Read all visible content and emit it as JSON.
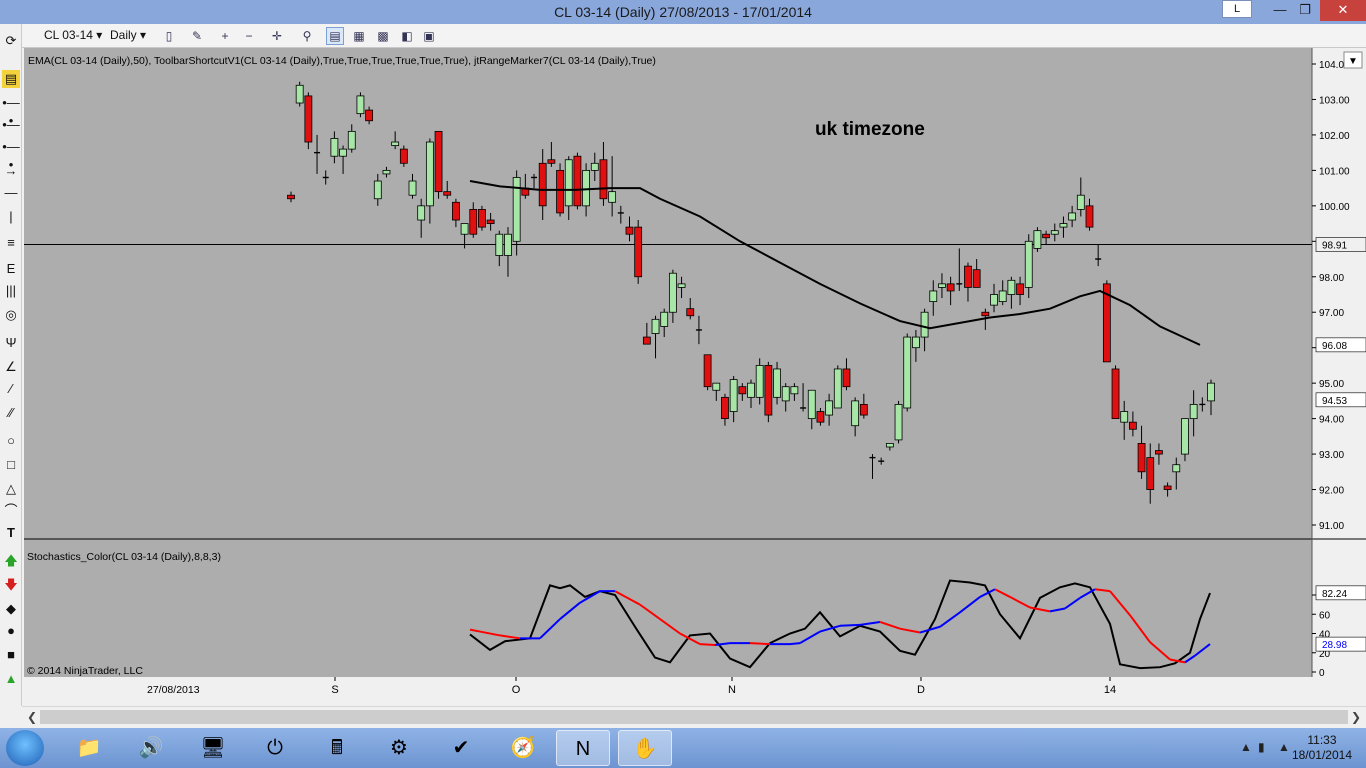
{
  "window": {
    "title": "CL 03-14 (Daily)  27/08/2013 - 17/01/2014",
    "keyboard_indicator": "L"
  },
  "toolbar": {
    "instrument": "CL 03-14",
    "period": "Daily"
  },
  "chart": {
    "indicator_label": "EMA(CL 03-14 (Daily),50), ToolbarShortcutV1(CL 03-14 (Daily),True,True,True,True,True,True), jtRangeMarker7(CL 03-14 (Daily),True)",
    "stoch_label": "Stochastics_Color(CL 03-14 (Daily),8,8,3)",
    "annotation": "uk timezone",
    "copyright": "© 2014 NinjaTrader, LLC",
    "start_date": "27/08/2013",
    "x_labels": [
      "S",
      "O",
      "N",
      "D",
      "14"
    ],
    "price_ticks": [
      "104.0",
      "103.00",
      "102.00",
      "101.00",
      "100.00",
      "99.00",
      "98.00",
      "97.00",
      "96.00",
      "95.00",
      "94.00",
      "93.00",
      "92.00",
      "91.00"
    ],
    "price_markers": {
      "hline": "98.91",
      "ema": "96.08",
      "last": "94.53"
    },
    "stoch_ticks": [
      "80",
      "60",
      "40",
      "20",
      "0"
    ],
    "stoch_markers": {
      "k": "82.24",
      "d": "28.98"
    },
    "colors": {
      "background": "#adadad",
      "up": "#a8e6a8",
      "down": "#e01010",
      "ema": "#000000",
      "stoch_k": "#000000",
      "stoch_d": "#0000ff",
      "stoch_d_down": "#ff0000"
    }
  },
  "chart_data": [
    {
      "type": "candlestick",
      "title": "CL 03-14 (Daily)",
      "ylim": [
        90.6,
        104.2
      ],
      "horizontal_line": 98.91,
      "candles": [
        [
          100.3,
          100.4,
          100.1,
          100.2
        ],
        [
          102.9,
          103.5,
          102.8,
          103.4
        ],
        [
          103.1,
          103.2,
          101.6,
          101.8
        ],
        [
          101.5,
          102.0,
          100.9,
          101.5
        ],
        [
          100.8,
          101.0,
          100.6,
          100.8
        ],
        [
          101.4,
          102.1,
          101.2,
          101.9
        ],
        [
          101.4,
          101.7,
          100.9,
          101.6
        ],
        [
          101.6,
          102.3,
          101.5,
          102.1
        ],
        [
          102.6,
          103.2,
          102.5,
          103.1
        ],
        [
          102.7,
          102.8,
          102.3,
          102.4
        ],
        [
          100.2,
          100.9,
          100.0,
          100.7
        ],
        [
          100.9,
          101.1,
          100.8,
          101.0
        ],
        [
          101.7,
          102.1,
          101.6,
          101.8
        ],
        [
          101.6,
          101.7,
          101.1,
          101.2
        ],
        [
          100.3,
          100.9,
          100.2,
          100.7
        ],
        [
          99.6,
          100.2,
          99.1,
          100.0
        ],
        [
          100.0,
          101.9,
          99.5,
          101.8
        ],
        [
          102.1,
          102.1,
          100.2,
          100.4
        ],
        [
          100.4,
          100.7,
          100.2,
          100.3
        ],
        [
          100.1,
          100.2,
          99.4,
          99.6
        ],
        [
          99.2,
          99.5,
          98.8,
          99.5
        ],
        [
          99.9,
          100.1,
          99.1,
          99.2
        ],
        [
          99.9,
          100.0,
          99.3,
          99.4
        ],
        [
          99.6,
          99.8,
          99.3,
          99.5
        ],
        [
          98.6,
          99.3,
          98.3,
          99.2
        ],
        [
          98.6,
          99.4,
          98.0,
          99.2
        ],
        [
          99.0,
          101.0,
          98.6,
          100.8
        ],
        [
          100.5,
          100.9,
          100.2,
          100.3
        ],
        [
          100.8,
          100.9,
          100.5,
          100.8
        ],
        [
          101.2,
          101.6,
          99.6,
          100.0
        ],
        [
          101.3,
          101.8,
          101.1,
          101.2
        ],
        [
          101.0,
          101.2,
          99.7,
          99.8
        ],
        [
          100.0,
          101.4,
          99.6,
          101.3
        ],
        [
          101.4,
          101.5,
          99.9,
          100.0
        ],
        [
          100.0,
          101.2,
          99.7,
          101.0
        ],
        [
          101.0,
          101.5,
          100.7,
          101.2
        ],
        [
          101.3,
          101.8,
          100.0,
          100.2
        ],
        [
          100.1,
          101.4,
          99.7,
          100.4
        ],
        [
          99.8,
          100.0,
          99.5,
          99.8
        ],
        [
          99.4,
          99.7,
          99.0,
          99.2
        ],
        [
          99.4,
          99.6,
          97.8,
          98.0
        ],
        [
          96.3,
          96.7,
          96.1,
          96.1
        ],
        [
          96.4,
          96.9,
          95.7,
          96.8
        ],
        [
          96.6,
          97.1,
          96.3,
          97.0
        ],
        [
          97.0,
          98.2,
          96.7,
          98.1
        ],
        [
          97.7,
          98.0,
          97.4,
          97.8
        ],
        [
          97.1,
          97.4,
          96.8,
          96.9
        ],
        [
          96.5,
          96.9,
          96.1,
          96.5
        ],
        [
          95.8,
          95.8,
          94.8,
          94.9
        ],
        [
          94.8,
          95.0,
          94.5,
          95.0
        ],
        [
          94.6,
          94.7,
          93.8,
          94.0
        ],
        [
          94.2,
          95.2,
          93.9,
          95.1
        ],
        [
          94.9,
          95.0,
          94.5,
          94.7
        ],
        [
          94.6,
          95.1,
          94.3,
          95.0
        ],
        [
          94.6,
          95.7,
          94.4,
          95.5
        ],
        [
          95.5,
          95.6,
          93.9,
          94.1
        ],
        [
          94.6,
          95.6,
          94.4,
          95.4
        ],
        [
          94.5,
          95.0,
          94.2,
          94.9
        ],
        [
          94.7,
          95.0,
          94.5,
          94.9
        ],
        [
          94.3,
          95.0,
          94.2,
          94.3
        ],
        [
          94.0,
          94.8,
          93.7,
          94.8
        ],
        [
          94.2,
          94.3,
          93.8,
          93.9
        ],
        [
          94.1,
          94.7,
          93.8,
          94.5
        ],
        [
          94.3,
          95.5,
          94.3,
          95.4
        ],
        [
          95.4,
          95.7,
          94.8,
          94.9
        ],
        [
          93.8,
          94.6,
          93.5,
          94.5
        ],
        [
          94.4,
          94.7,
          94.0,
          94.1
        ],
        [
          92.9,
          93.0,
          92.3,
          92.9
        ],
        [
          92.8,
          92.9,
          92.7,
          92.8
        ],
        [
          93.2,
          93.3,
          93.1,
          93.3
        ],
        [
          93.4,
          94.5,
          93.3,
          94.4
        ],
        [
          94.3,
          96.4,
          94.2,
          96.3
        ],
        [
          96.0,
          96.5,
          95.6,
          96.3
        ],
        [
          96.3,
          97.1,
          95.9,
          97.0
        ],
        [
          97.3,
          97.9,
          96.9,
          97.6
        ],
        [
          97.7,
          98.1,
          97.4,
          97.8
        ],
        [
          97.8,
          98.0,
          97.2,
          97.6
        ],
        [
          97.8,
          98.8,
          97.6,
          97.8
        ],
        [
          98.3,
          98.4,
          97.3,
          97.7
        ],
        [
          98.2,
          98.5,
          97.8,
          97.7
        ],
        [
          97.0,
          97.1,
          96.5,
          96.9
        ],
        [
          97.2,
          97.8,
          97.0,
          97.5
        ],
        [
          97.3,
          97.9,
          97.2,
          97.6
        ],
        [
          97.5,
          98.0,
          97.1,
          97.9
        ],
        [
          97.8,
          98.0,
          97.2,
          97.5
        ],
        [
          97.7,
          99.2,
          97.4,
          99.0
        ],
        [
          98.8,
          99.4,
          98.7,
          99.3
        ],
        [
          99.2,
          99.3,
          98.9,
          99.1
        ],
        [
          99.2,
          99.5,
          99.0,
          99.3
        ],
        [
          99.4,
          99.7,
          99.1,
          99.5
        ],
        [
          99.6,
          100.0,
          99.4,
          99.8
        ],
        [
          99.9,
          100.8,
          99.7,
          100.3
        ],
        [
          100.0,
          100.2,
          99.3,
          99.4
        ],
        [
          98.5,
          98.9,
          98.3,
          98.5
        ],
        [
          97.8,
          97.9,
          96.0,
          95.6
        ],
        [
          95.4,
          95.5,
          94.2,
          94.0
        ],
        [
          93.9,
          94.5,
          93.4,
          94.2
        ],
        [
          93.9,
          94.2,
          93.5,
          93.7
        ],
        [
          93.3,
          93.8,
          92.3,
          92.5
        ],
        [
          92.9,
          93.3,
          91.6,
          92.0
        ],
        [
          93.1,
          93.3,
          92.7,
          93.0
        ],
        [
          92.1,
          92.2,
          91.8,
          92.0
        ],
        [
          92.5,
          92.9,
          92.0,
          92.7
        ],
        [
          93.0,
          94.0,
          92.8,
          94.0
        ],
        [
          94.0,
          94.8,
          93.5,
          94.4
        ],
        [
          94.4,
          94.6,
          94.2,
          94.4
        ],
        [
          94.5,
          95.1,
          94.1,
          95.0
        ]
      ],
      "ema": [
        [
          470,
          100.7
        ],
        [
          500,
          100.55
        ],
        [
          540,
          100.45
        ],
        [
          575,
          100.45
        ],
        [
          610,
          100.5
        ],
        [
          640,
          100.5
        ],
        [
          660,
          100.2
        ],
        [
          700,
          99.7
        ],
        [
          740,
          99.0
        ],
        [
          780,
          98.4
        ],
        [
          820,
          97.8
        ],
        [
          860,
          97.25
        ],
        [
          900,
          96.75
        ],
        [
          930,
          96.55
        ],
        [
          960,
          96.7
        ],
        [
          990,
          96.85
        ],
        [
          1020,
          96.95
        ],
        [
          1050,
          97.1
        ],
        [
          1080,
          97.45
        ],
        [
          1100,
          97.6
        ],
        [
          1130,
          97.2
        ],
        [
          1160,
          96.6
        ],
        [
          1200,
          96.08
        ]
      ]
    },
    {
      "type": "line",
      "title": "Stochastics_Color(CL 03-14 (Daily),8,8,3)",
      "ylim": [
        0,
        100
      ],
      "series": [
        {
          "values": [
            [
              470,
              39
            ],
            [
              490,
              23
            ],
            [
              505,
              32
            ],
            [
              530,
              35
            ],
            [
              550,
              90
            ],
            [
              560,
              87
            ],
            [
              570,
              90
            ],
            [
              585,
              78
            ],
            [
              600,
              84
            ],
            [
              615,
              80
            ],
            [
              635,
              47
            ],
            [
              655,
              15
            ],
            [
              670,
              10
            ],
            [
              690,
              38
            ],
            [
              710,
              40
            ],
            [
              730,
              14
            ],
            [
              750,
              5
            ],
            [
              770,
              30
            ],
            [
              790,
              40
            ],
            [
              805,
              45
            ],
            [
              820,
              62
            ],
            [
              840,
              37
            ],
            [
              860,
              48
            ],
            [
              880,
              42
            ],
            [
              900,
              22
            ],
            [
              915,
              18
            ],
            [
              935,
              55
            ],
            [
              950,
              95
            ],
            [
              970,
              93
            ],
            [
              985,
              90
            ],
            [
              1000,
              60
            ],
            [
              1020,
              35
            ],
            [
              1040,
              77
            ],
            [
              1060,
              88
            ],
            [
              1075,
              92
            ],
            [
              1090,
              88
            ],
            [
              1110,
              50
            ],
            [
              1120,
              8
            ],
            [
              1140,
              4
            ],
            [
              1160,
              5
            ],
            [
              1175,
              9
            ],
            [
              1190,
              20
            ],
            [
              1200,
              55
            ],
            [
              1210,
              82
            ]
          ]
        },
        {
          "values": [
            [
              470,
              44
            ],
            [
              480,
              42
            ],
            [
              500,
              38
            ],
            [
              520,
              35
            ],
            [
              540,
              35
            ],
            [
              560,
              55
            ],
            [
              580,
              72
            ],
            [
              600,
              84
            ],
            [
              615,
              84
            ],
            [
              640,
              70
            ],
            [
              660,
              55
            ],
            [
              680,
              40
            ],
            [
              700,
              29
            ],
            [
              715,
              28
            ],
            [
              730,
              30
            ],
            [
              750,
              30
            ],
            [
              770,
              29
            ],
            [
              790,
              29
            ],
            [
              800,
              30
            ],
            [
              820,
              42
            ],
            [
              840,
              48
            ],
            [
              860,
              49
            ],
            [
              880,
              52
            ],
            [
              900,
              45
            ],
            [
              920,
              41
            ],
            [
              940,
              47
            ],
            [
              960,
              62
            ],
            [
              980,
              78
            ],
            [
              995,
              86
            ],
            [
              1010,
              78
            ],
            [
              1030,
              67
            ],
            [
              1050,
              63
            ],
            [
              1065,
              66
            ],
            [
              1080,
              77
            ],
            [
              1095,
              86
            ],
            [
              1110,
              84
            ],
            [
              1130,
              59
            ],
            [
              1150,
              31
            ],
            [
              1170,
              13
            ],
            [
              1185,
              10
            ],
            [
              1195,
              17
            ],
            [
              1210,
              29
            ]
          ]
        }
      ]
    }
  ]
}
